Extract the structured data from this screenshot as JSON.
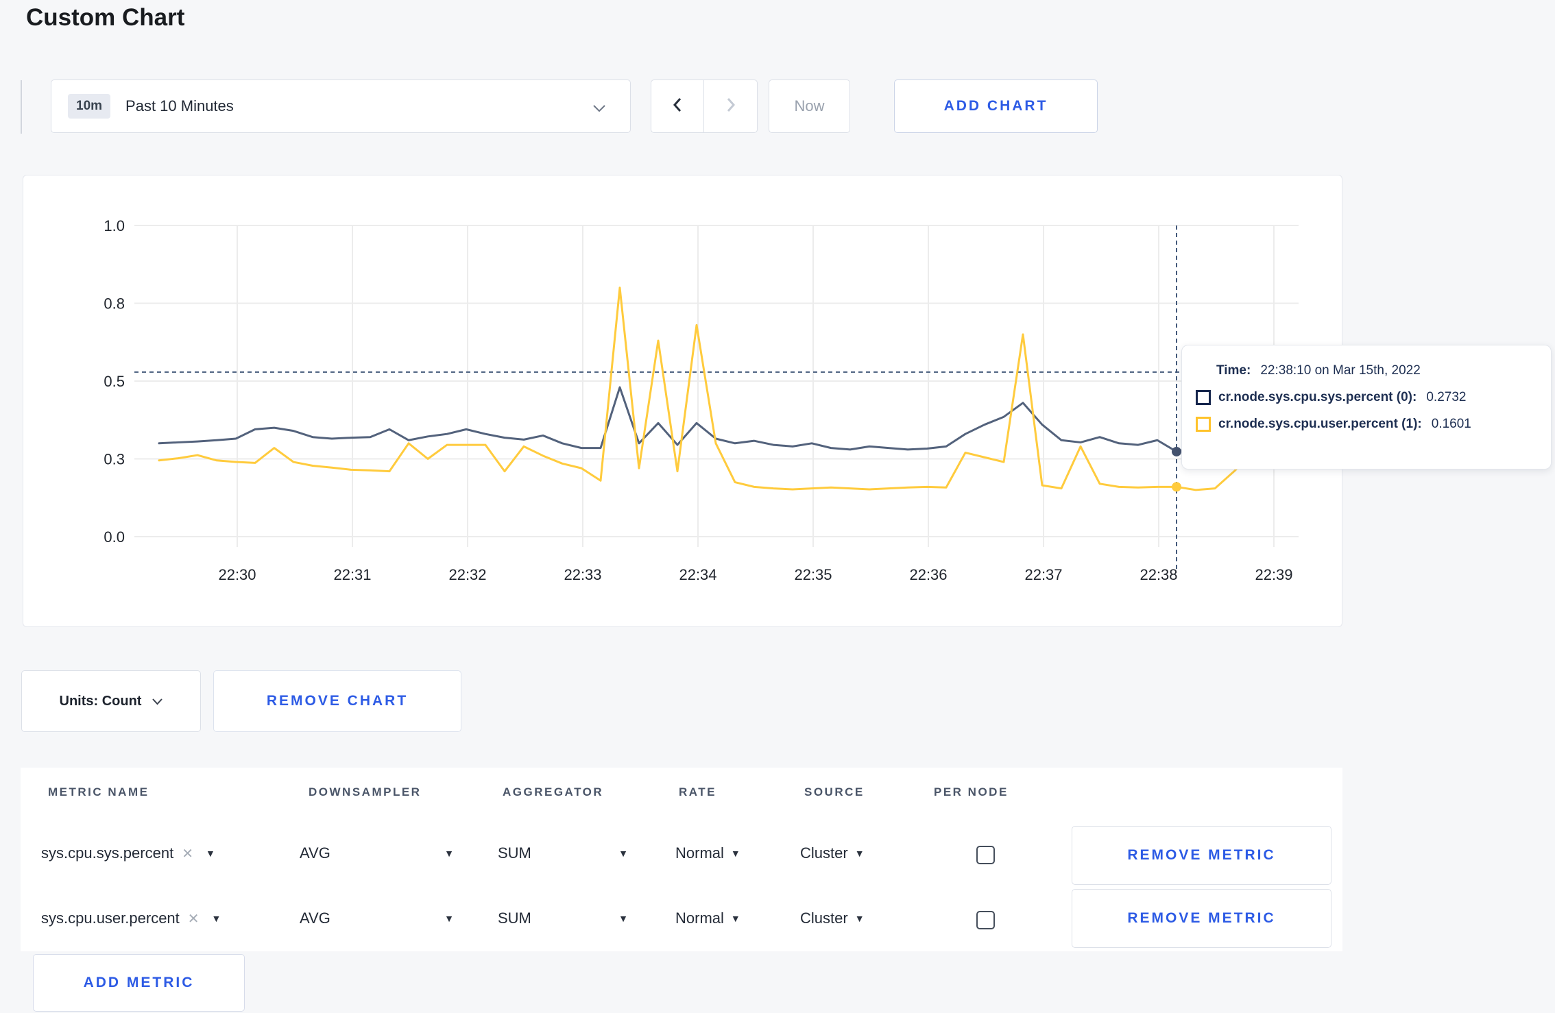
{
  "page": {
    "title": "Custom Chart"
  },
  "toolbar": {
    "time_window": {
      "badge": "10m",
      "label": "Past 10 Minutes"
    },
    "now_label": "Now",
    "add_chart_label": "ADD CHART"
  },
  "chart_data": {
    "type": "line",
    "x_start": "22:29:20",
    "x_interval_seconds": 10,
    "x_tick_labels": [
      "22:30",
      "22:31",
      "22:32",
      "22:33",
      "22:34",
      "22:35",
      "22:36",
      "22:37",
      "22:38",
      "22:39"
    ],
    "y_ticks": [
      {
        "value": 0.0,
        "label": "0.0"
      },
      {
        "value": 0.25,
        "label": "0.3"
      },
      {
        "value": 0.5,
        "label": "0.5"
      },
      {
        "value": 0.75,
        "label": "0.8"
      },
      {
        "value": 1.0,
        "label": "1.0"
      }
    ],
    "ylim": [
      0,
      1
    ],
    "grid": true,
    "series": [
      {
        "name": "cr.node.sys.cpu.sys.percent",
        "color": "#53627c",
        "values": [
          0.3,
          0.303,
          0.306,
          0.31,
          0.315,
          0.345,
          0.35,
          0.34,
          0.32,
          0.315,
          0.318,
          0.32,
          0.345,
          0.31,
          0.322,
          0.33,
          0.345,
          0.33,
          0.318,
          0.312,
          0.325,
          0.3,
          0.285,
          0.285,
          0.48,
          0.3,
          0.365,
          0.295,
          0.365,
          0.315,
          0.3,
          0.308,
          0.295,
          0.29,
          0.3,
          0.285,
          0.28,
          0.29,
          0.285,
          0.28,
          0.283,
          0.29,
          0.33,
          0.36,
          0.385,
          0.43,
          0.36,
          0.31,
          0.303,
          0.32,
          0.3,
          0.295,
          0.31,
          0.2732,
          0.29,
          0.285,
          0.295,
          0.3,
          0.31,
          0.3
        ]
      },
      {
        "name": "cr.node.sys.cpu.user.percent",
        "color": "#ffcb3d",
        "values": [
          0.245,
          0.252,
          0.262,
          0.245,
          0.24,
          0.237,
          0.285,
          0.24,
          0.228,
          0.222,
          0.215,
          0.213,
          0.21,
          0.3,
          0.25,
          0.295,
          0.295,
          0.295,
          0.21,
          0.29,
          0.26,
          0.235,
          0.22,
          0.18,
          0.8,
          0.22,
          0.63,
          0.21,
          0.68,
          0.3,
          0.175,
          0.16,
          0.155,
          0.152,
          0.155,
          0.158,
          0.155,
          0.152,
          0.155,
          0.158,
          0.16,
          0.158,
          0.27,
          0.255,
          0.24,
          0.65,
          0.165,
          0.155,
          0.29,
          0.17,
          0.16,
          0.158,
          0.16,
          0.1601,
          0.15,
          0.155,
          0.21,
          0.27,
          0.285,
          0.235
        ]
      }
    ],
    "crosshair": {
      "time": "22:38:10",
      "x_offset_seconds": 530,
      "y_value": 0.529,
      "points": [
        0.2732,
        0.1601
      ]
    }
  },
  "tooltip": {
    "time_label": "Time:",
    "time_value": "22:38:10 on Mar 15th, 2022",
    "series": [
      {
        "label": "cr.node.sys.cpu.sys.percent (0):",
        "value": "0.2732",
        "color": "#16264d"
      },
      {
        "label": "cr.node.sys.cpu.user.percent (1):",
        "value": "0.1601",
        "color": "#ffc32b"
      }
    ]
  },
  "chart_controls": {
    "units_label": "Units: Count",
    "remove_chart_label": "REMOVE CHART"
  },
  "metrics_table": {
    "headers": [
      "METRIC NAME",
      "DOWNSAMPLER",
      "AGGREGATOR",
      "RATE",
      "SOURCE",
      "PER NODE"
    ],
    "rows": [
      {
        "metric_name": "sys.cpu.sys.percent",
        "downsampler": "AVG",
        "aggregator": "SUM",
        "rate": "Normal",
        "source": "Cluster",
        "per_node_checked": false,
        "remove_label": "REMOVE METRIC"
      },
      {
        "metric_name": "sys.cpu.user.percent",
        "downsampler": "AVG",
        "aggregator": "SUM",
        "rate": "Normal",
        "source": "Cluster",
        "per_node_checked": false,
        "remove_label": "REMOVE METRIC"
      }
    ],
    "add_metric_label": "ADD METRIC"
  },
  "colors": {
    "accent_blue": "#2d5be5",
    "series_sys": "#53627c",
    "series_user": "#ffcb3d"
  }
}
